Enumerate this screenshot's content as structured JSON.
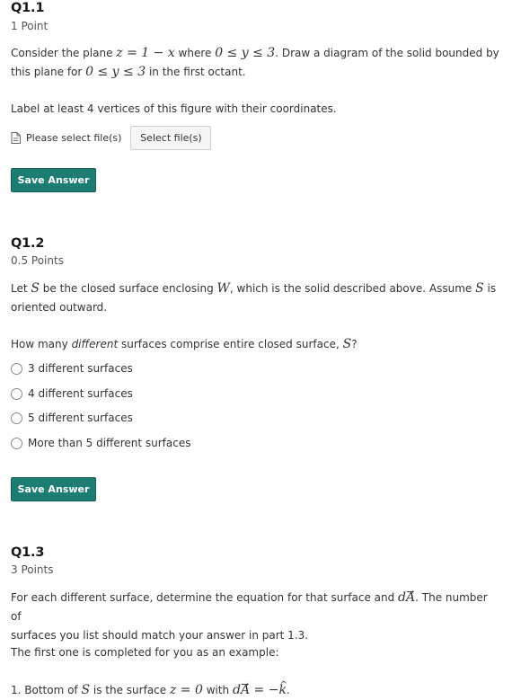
{
  "q1": {
    "title": "Q1.1",
    "points": "1 Point",
    "line1_a": "Consider the plane ",
    "line1_b": " where ",
    "line1_c": ". Draw a diagram of the solid bounded by",
    "line2_a": "this plane for ",
    "line2_b": " in the first octant.",
    "math_plane": "z = 1 − x",
    "math_yrange": "0 ≤ y ≤ 3",
    "instruction": "Label at least 4 vertices of this figure with their coordinates.",
    "file_placeholder": "Please select file(s)",
    "select_files_label": "Select file(s)",
    "save_label": "Save Answer"
  },
  "q2": {
    "title": "Q1.2",
    "points": "0.5 Points",
    "line1_a": "Let ",
    "line1_b": " be the closed surface enclosing ",
    "line1_c": ", which is the solid described above. Assume ",
    "line1_d": " is",
    "line2": "oriented outward.",
    "math_S": "S",
    "math_W": "W",
    "question_a": "How many ",
    "question_em": "different",
    "question_b": " surfaces comprise entire closed surface, ",
    "question_c": "?",
    "options": [
      "3 different surfaces",
      "4 different surfaces",
      "5 different surfaces",
      "More than 5 different surfaces"
    ],
    "save_label": "Save Answer"
  },
  "q3": {
    "title": "Q1.3",
    "points": "3 Points",
    "line1_a": "For each different surface, determine the equation for that surface and ",
    "line1_b": ". The number of",
    "line2": "surfaces you list should match your answer in part 1.3.",
    "example_intro": "The first one is completed for you as an example:",
    "ex_a": "1. Bottom of ",
    "ex_b": " is the surface ",
    "ex_c": " with ",
    "ex_d": ".",
    "math_S": "S",
    "math_z0": "z = 0",
    "math_dA": "dA",
    "math_k": "k"
  }
}
